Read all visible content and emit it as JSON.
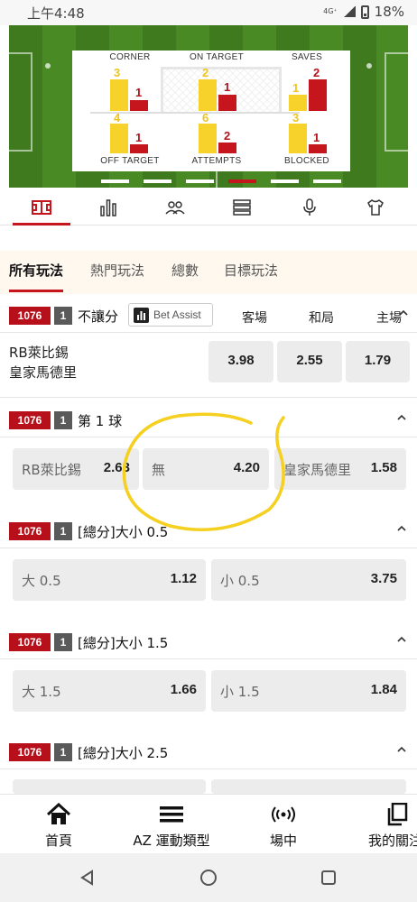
{
  "status_bar": {
    "time": "上午4:48",
    "network": "4G⁺",
    "battery": "18%"
  },
  "stats_panel": {
    "corner": {
      "label": "CORNER",
      "home": "3",
      "away": "1"
    },
    "on_target": {
      "label": "ON TARGET",
      "home": "2",
      "away": "1"
    },
    "saves": {
      "label": "SAVES",
      "home": "1",
      "away": "2"
    },
    "off_target": {
      "label": "OFF TARGET",
      "home": "4",
      "away": "1"
    },
    "attempts": {
      "label": "ATTEMPTS",
      "home": "6",
      "away": "2"
    },
    "blocked": {
      "label": "BLOCKED",
      "home": "3",
      "away": "1"
    },
    "pager": {
      "count": 6,
      "active_index": 3
    }
  },
  "icon_tabs": [
    "pitch-icon",
    "stats-chart-icon",
    "lineup-icon",
    "list-icon",
    "microphone-icon",
    "jersey-icon"
  ],
  "market_tabs": [
    "所有玩法",
    "熱門玩法",
    "總數",
    "目標玩法"
  ],
  "markets": {
    "m1": {
      "id": "1076",
      "count": "1",
      "title": "不讓分",
      "bet_assist": "Bet Assist",
      "cols": [
        "客場",
        "和局",
        "主場"
      ],
      "team1": "RB萊比錫",
      "team2": "皇家馬德里",
      "odds": [
        "3.98",
        "2.55",
        "1.79"
      ]
    },
    "m2": {
      "id": "1076",
      "count": "1",
      "title": "第 1 球",
      "o1": {
        "label": "RB萊比錫",
        "value": "2.63"
      },
      "o2": {
        "label": "無",
        "value": "4.20"
      },
      "o3": {
        "label": "皇家馬德里",
        "value": "1.58"
      }
    },
    "m3": {
      "id": "1076",
      "count": "1",
      "title": "[總分]大小 0.5",
      "o1": {
        "label": "大 0.5",
        "value": "1.12"
      },
      "o2": {
        "label": "小 0.5",
        "value": "3.75"
      }
    },
    "m4": {
      "id": "1076",
      "count": "1",
      "title": "[總分]大小 1.5",
      "o1": {
        "label": "大 1.5",
        "value": "1.66"
      },
      "o2": {
        "label": "小 1.5",
        "value": "1.84"
      }
    },
    "m5": {
      "id": "1076",
      "count": "1",
      "title": "[總分]大小 2.5"
    }
  },
  "bottom_nav": {
    "home": "首頁",
    "sports": "AZ 運動類型",
    "live": "場中",
    "mybets": "我的關注"
  },
  "colors": {
    "accent": "#c4161c",
    "yellow": "#f7d22a",
    "pitch": "#4a8a25",
    "annotation": "#f5d020"
  }
}
